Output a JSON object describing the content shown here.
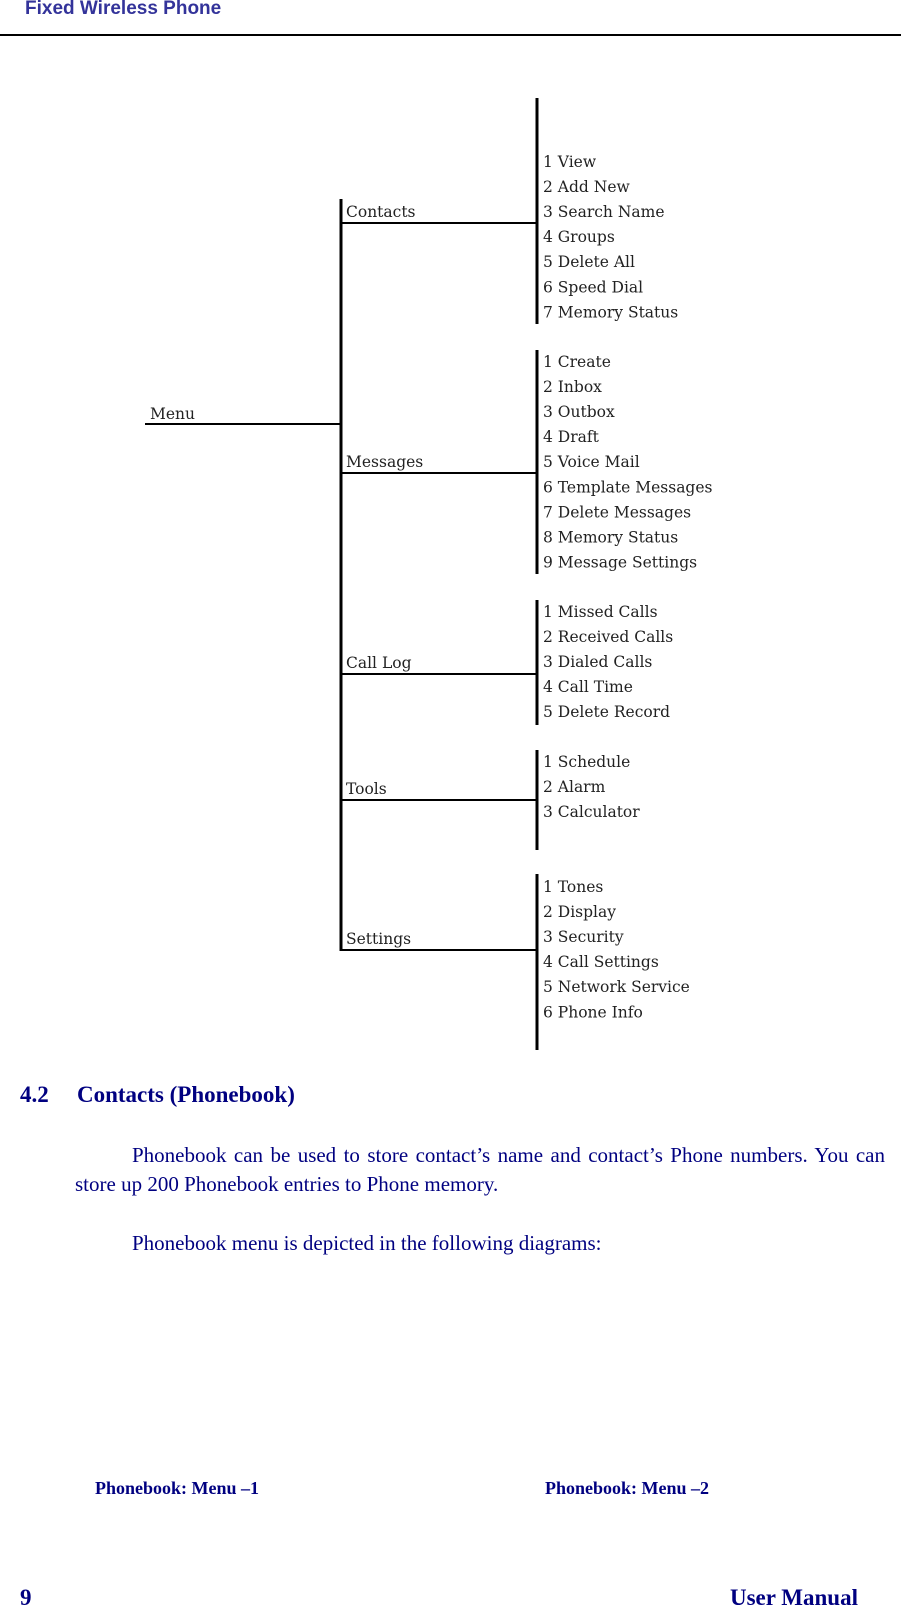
{
  "header": {
    "title": "Fixed Wireless Phone"
  },
  "diagram": {
    "root": "Menu",
    "branches": [
      {
        "label": "Contacts",
        "items": [
          "1 View",
          "2 Add New",
          "3 Search Name",
          "4 Groups",
          "5 Delete All",
          "6 Speed Dial",
          "7 Memory Status"
        ]
      },
      {
        "label": "Messages",
        "items": [
          "1 Create",
          "2 Inbox",
          "3 Outbox",
          "4 Draft",
          "5 Voice Mail",
          "6 Template Messages",
          "7 Delete Messages",
          "8 Memory Status",
          "9 Message Settings"
        ]
      },
      {
        "label": "Call Log",
        "items": [
          "1 Missed Calls",
          "2 Received Calls",
          "3 Dialed Calls",
          "4 Call Time",
          "5 Delete Record"
        ]
      },
      {
        "label": "Tools",
        "items": [
          "1 Schedule",
          "2 Alarm",
          "3 Calculator"
        ]
      },
      {
        "label": "Settings",
        "items": [
          "1 Tones",
          "2 Display",
          "3 Security",
          "4 Call Settings",
          "5 Network Service",
          "6 Phone Info"
        ]
      }
    ]
  },
  "section": {
    "number": "4.2",
    "title": "Contacts (Phonebook)",
    "paragraph1": "Phonebook can be used to store contact’s name and contact’s Phone numbers. You can store up  200 Phonebook entries to Phone memory.",
    "paragraph2": "Phonebook menu is depicted in the following diagrams:"
  },
  "captions": [
    "Phonebook: Menu –1",
    "Phonebook: Menu –2"
  ],
  "footer": {
    "page_number": "9",
    "label": "User Manual"
  }
}
